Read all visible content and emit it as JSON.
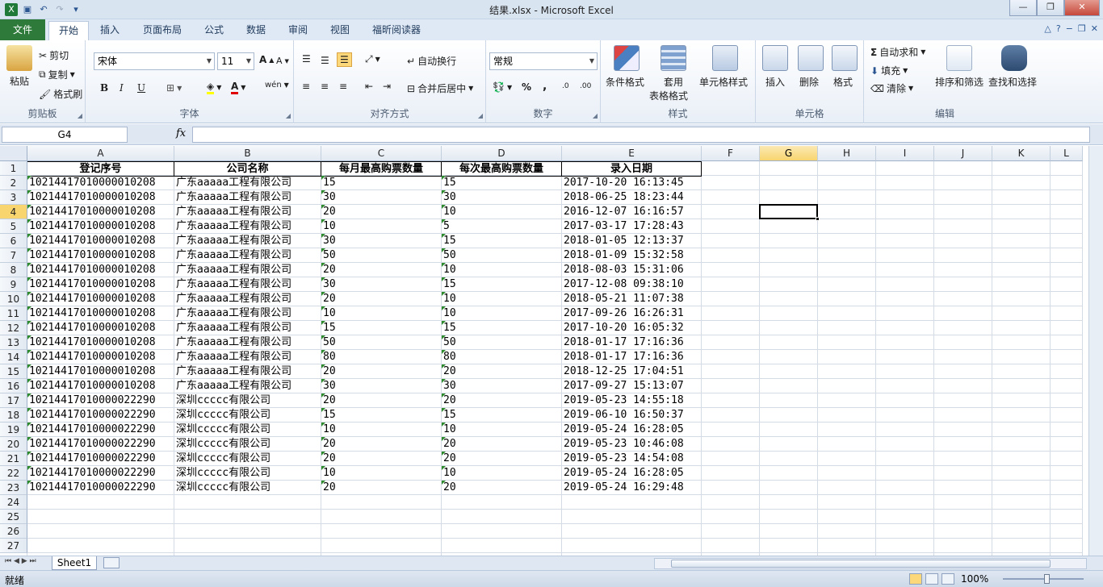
{
  "window": {
    "title": "结果.xlsx - Microsoft Excel",
    "minimize": "—",
    "restore": "❐",
    "close": "✕"
  },
  "tabs": {
    "file": "文件",
    "items": [
      "开始",
      "插入",
      "页面布局",
      "公式",
      "数据",
      "审阅",
      "视图",
      "福昕阅读器"
    ]
  },
  "ribbon": {
    "clipboard": {
      "label": "剪贴板",
      "paste": "粘贴",
      "cut": "剪切",
      "copy": "复制",
      "format_painter": "格式刷"
    },
    "font": {
      "label": "字体",
      "font_name": "宋体",
      "font_size": "11",
      "bold": "B",
      "italic": "I",
      "underline": "U",
      "grow": "A",
      "shrink": "A",
      "font_color": "A",
      "wen": "wén"
    },
    "alignment": {
      "label": "对齐方式",
      "wrap": "自动换行",
      "merge": "合并后居中"
    },
    "number": {
      "label": "数字",
      "format": "常规",
      "percent": "%",
      "comma": ",",
      "inc": ".0",
      "dec": ".00"
    },
    "styles": {
      "label": "样式",
      "conditional": "条件格式",
      "table": "套用",
      "table2": "表格格式",
      "cell_styles": "单元格样式"
    },
    "cells": {
      "label": "单元格",
      "insert": "插入",
      "delete": "删除",
      "format": "格式"
    },
    "editing": {
      "label": "编辑",
      "autosum": "自动求和",
      "fill": "填充",
      "clear": "清除",
      "sort": "排序和筛选",
      "find": "查找和选择"
    }
  },
  "formula_bar": {
    "name_box": "G4",
    "fx": "fx",
    "content": ""
  },
  "columns": [
    "A",
    "B",
    "C",
    "D",
    "E",
    "F",
    "G",
    "H",
    "I",
    "J",
    "K",
    "L"
  ],
  "header_row": [
    "登记序号",
    "公司名称",
    "每月最高购票数量",
    "每次最高购票数量",
    "录入日期"
  ],
  "rows": [
    [
      "10214417010000010208",
      "广东aaaaa工程有限公司",
      "15",
      "15",
      "2017-10-20 16:13:45"
    ],
    [
      "10214417010000010208",
      "广东aaaaa工程有限公司",
      "30",
      "30",
      "2018-06-25 18:23:44"
    ],
    [
      "10214417010000010208",
      "广东aaaaa工程有限公司",
      "20",
      "10",
      "2016-12-07 16:16:57"
    ],
    [
      "10214417010000010208",
      "广东aaaaa工程有限公司",
      "10",
      "5",
      "2017-03-17 17:28:43"
    ],
    [
      "10214417010000010208",
      "广东aaaaa工程有限公司",
      "30",
      "15",
      "2018-01-05 12:13:37"
    ],
    [
      "10214417010000010208",
      "广东aaaaa工程有限公司",
      "50",
      "50",
      "2018-01-09 15:32:58"
    ],
    [
      "10214417010000010208",
      "广东aaaaa工程有限公司",
      "20",
      "10",
      "2018-08-03 15:31:06"
    ],
    [
      "10214417010000010208",
      "广东aaaaa工程有限公司",
      "30",
      "15",
      "2017-12-08 09:38:10"
    ],
    [
      "10214417010000010208",
      "广东aaaaa工程有限公司",
      "20",
      "10",
      "2018-05-21 11:07:38"
    ],
    [
      "10214417010000010208",
      "广东aaaaa工程有限公司",
      "10",
      "10",
      "2017-09-26 16:26:31"
    ],
    [
      "10214417010000010208",
      "广东aaaaa工程有限公司",
      "15",
      "15",
      "2017-10-20 16:05:32"
    ],
    [
      "10214417010000010208",
      "广东aaaaa工程有限公司",
      "50",
      "50",
      "2018-01-17 17:16:36"
    ],
    [
      "10214417010000010208",
      "广东aaaaa工程有限公司",
      "80",
      "80",
      "2018-01-17 17:16:36"
    ],
    [
      "10214417010000010208",
      "广东aaaaa工程有限公司",
      "20",
      "20",
      "2018-12-25 17:04:51"
    ],
    [
      "10214417010000010208",
      "广东aaaaa工程有限公司",
      "30",
      "30",
      "2017-09-27 15:13:07"
    ],
    [
      "10214417010000022290",
      "深圳ccccc有限公司",
      "20",
      "20",
      "2019-05-23 14:55:18"
    ],
    [
      "10214417010000022290",
      "深圳ccccc有限公司",
      "15",
      "15",
      "2019-06-10 16:50:37"
    ],
    [
      "10214417010000022290",
      "深圳ccccc有限公司",
      "10",
      "10",
      "2019-05-24 16:28:05"
    ],
    [
      "10214417010000022290",
      "深圳ccccc有限公司",
      "20",
      "20",
      "2019-05-23 10:46:08"
    ],
    [
      "10214417010000022290",
      "深圳ccccc有限公司",
      "20",
      "20",
      "2019-05-23 14:54:08"
    ],
    [
      "10214417010000022290",
      "深圳ccccc有限公司",
      "10",
      "10",
      "2019-05-24 16:28:05"
    ],
    [
      "10214417010000022290",
      "深圳ccccc有限公司",
      "20",
      "20",
      "2019-05-24 16:29:48"
    ]
  ],
  "row_numbers": [
    "1",
    "2",
    "3",
    "4",
    "5",
    "6",
    "7",
    "8",
    "9",
    "10",
    "11",
    "12",
    "13",
    "14",
    "15",
    "16",
    "17",
    "18",
    "19",
    "20",
    "21",
    "22",
    "23",
    "24",
    "25",
    "26",
    "27"
  ],
  "sheets": [
    "Sheet1"
  ],
  "status": {
    "ready": "就绪",
    "zoom": "100%"
  },
  "colors": {
    "file_tab": "#2d7a3a",
    "selected_header": "#f8d56e",
    "text_marker": "#2d8b2d"
  }
}
